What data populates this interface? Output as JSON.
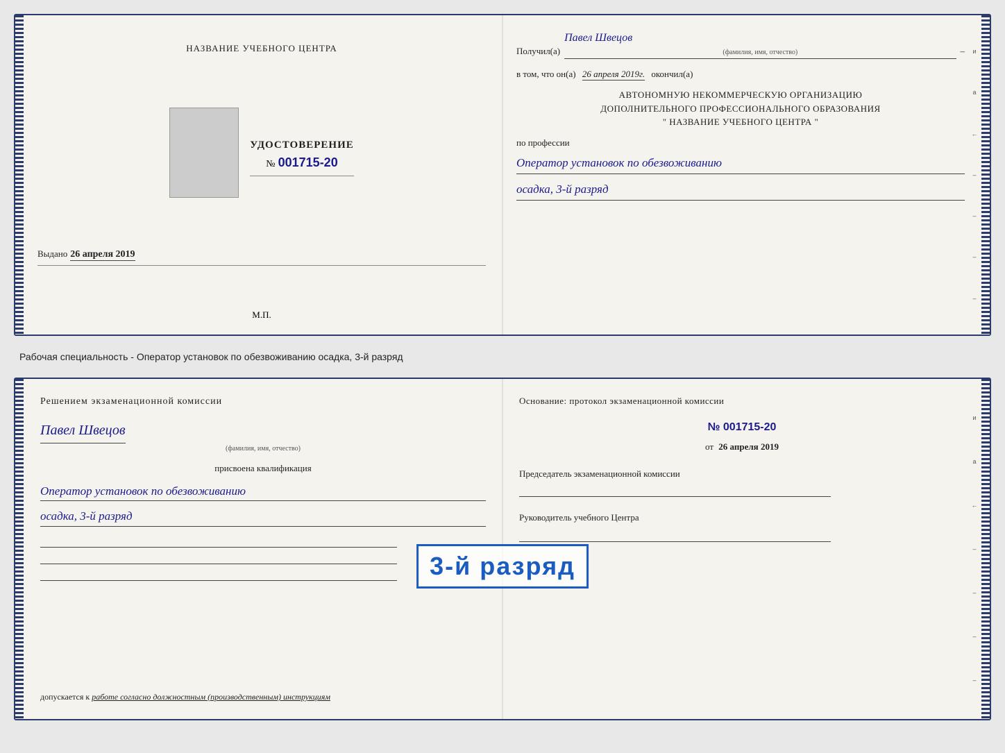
{
  "doc1": {
    "left": {
      "training_center": "НАЗВАНИЕ УЧЕБНОГО ЦЕНТРА",
      "cert_label": "УДОСТОВЕРЕНИЕ",
      "cert_no_prefix": "№",
      "cert_no": "001715-20",
      "issued_label": "Выдано",
      "issued_date": "26 апреля 2019",
      "mp": "М.П."
    },
    "right": {
      "received_label": "Получил(а)",
      "recipient_name": "Павел Швецов",
      "fio_label": "(фамилия, имя, отчество)",
      "dash": "–",
      "in_that_label": "в том, что он(а)",
      "date_value": "26 апреля 2019г.",
      "finished_label": "окончил(а)",
      "org_line1": "АВТОНОМНУЮ НЕКОММЕРЧЕСКУЮ ОРГАНИЗАЦИЮ",
      "org_line2": "ДОПОЛНИТЕЛЬНОГО ПРОФЕССИОНАЛЬНОГО ОБРАЗОВАНИЯ",
      "org_line3": "\" НАЗВАНИЕ УЧЕБНОГО ЦЕНТРА \"",
      "profession_label": "по профессии",
      "profession_value": "Оператор установок по обезвоживанию",
      "rank_value": "осадка, 3-й разряд",
      "right_chars": [
        "и",
        "а",
        "←",
        "–",
        "–",
        "–",
        "–"
      ]
    }
  },
  "between_label": "Рабочая специальность - Оператор установок по обезвоживанию осадка, 3-й разряд",
  "doc2": {
    "left": {
      "decision_title": "Решением  экзаменационной  комиссии",
      "person_name": "Павел Швецов",
      "fio_label": "(фамилия, имя, отчество)",
      "qual_label": "присвоена квалификация",
      "qual_value": "Оператор установок по обезвоживанию",
      "qual_rank": "осадка, 3-й разряд",
      "допускается_label": "допускается к",
      "допускается_value": "работе согласно должностным (производственным) инструкциям"
    },
    "right": {
      "basis_label": "Основание: протокол экзаменационной  комиссии",
      "no_prefix": "№",
      "no_value": "001715-20",
      "date_prefix": "от",
      "date_value": "26 апреля 2019",
      "chairman_label": "Председатель экзаменационной комиссии",
      "director_label": "Руководитель учебного Центра",
      "right_chars": [
        "и",
        "а",
        "←",
        "–",
        "–",
        "–",
        "–"
      ]
    },
    "stamp": {
      "text": "3-й разряд"
    }
  }
}
